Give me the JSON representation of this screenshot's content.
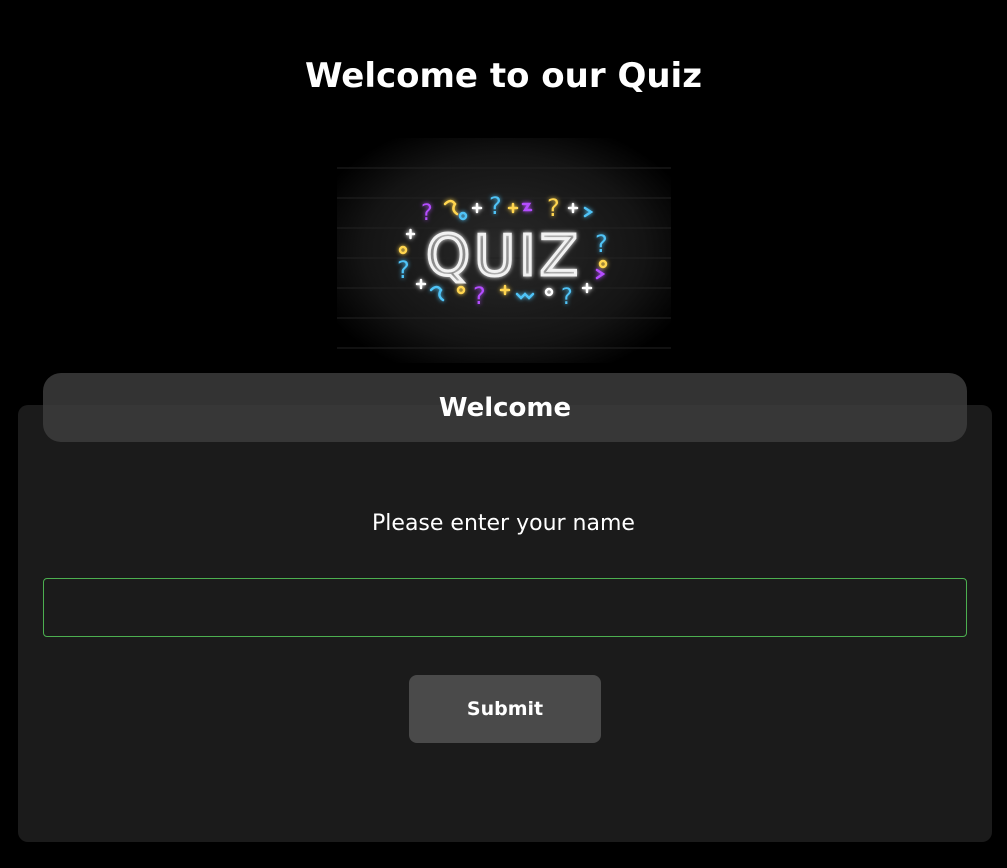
{
  "page": {
    "title": "Welcome to our Quiz"
  },
  "banner": {
    "text": "QUIZ",
    "neon_colors": [
      "#b44dff",
      "#4fc3f7",
      "#ffd54f",
      "#ffffff"
    ]
  },
  "card": {
    "title": "Welcome",
    "prompt": "Please enter your name",
    "name_input": {
      "value": "",
      "placeholder": ""
    },
    "submit_label": "Submit"
  },
  "colors": {
    "background": "#000000",
    "card_background": "#1b1b1b",
    "header_background": "#3e3e3e",
    "input_border": "#4caf50",
    "button_background": "#4a4a4a",
    "text": "#ffffff"
  }
}
